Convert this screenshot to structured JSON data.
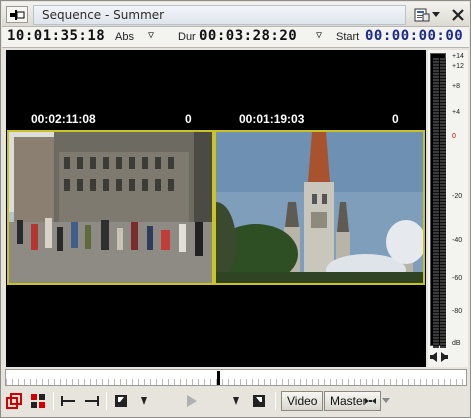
{
  "window": {
    "title": "Sequence - Summer"
  },
  "header": {
    "current_time": "10:01:35:18",
    "mode": "Abs",
    "dur_label": "Dur",
    "duration": "00:03:28:20",
    "start_label": "Start",
    "start_time": "00:00:00:00"
  },
  "preview": {
    "left": {
      "timecode": "00:02:11:08",
      "value": "0"
    },
    "right": {
      "timecode": "00:01:19:03",
      "value": "0"
    }
  },
  "meter": {
    "labels": [
      "+14",
      "+12",
      "+8",
      "+4",
      "0",
      "-20",
      "-40",
      "-60",
      "-80",
      "dB"
    ],
    "zero_color": "#d40000"
  },
  "toolbar": {
    "video_label": "Video",
    "master_label": "Master"
  },
  "colors": {
    "frame_border": "#c9c326",
    "accent_red": "#d40000"
  }
}
